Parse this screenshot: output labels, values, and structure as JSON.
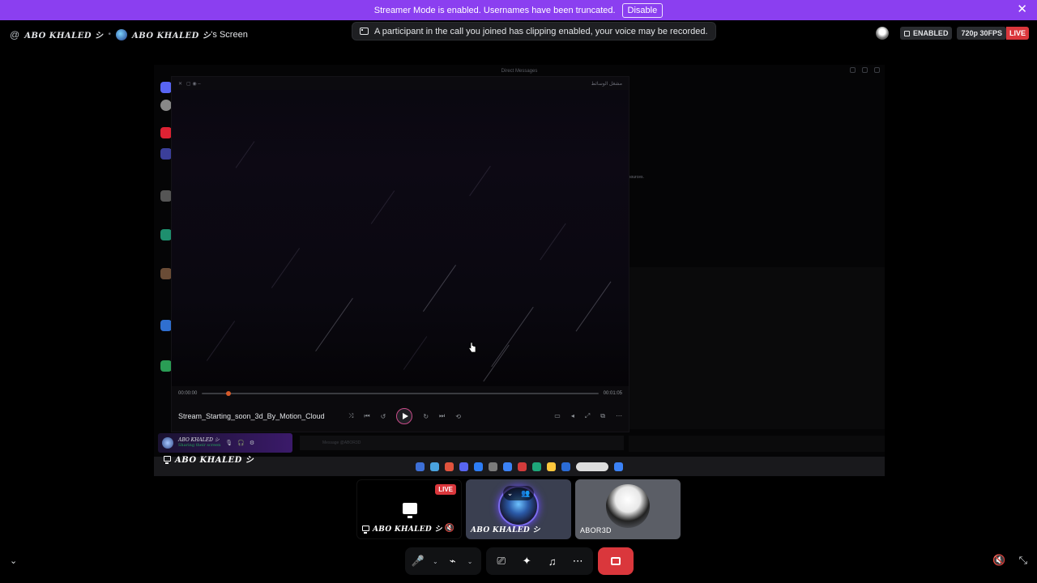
{
  "banner": {
    "text": "Streamer Mode is enabled. Usernames have been truncated.",
    "button": "Disable",
    "close": "✕"
  },
  "header": {
    "at": "@",
    "user": "ABO KHALED シ",
    "screen_owner": "ABO KHALED シ",
    "screen_suffix": "'s Screen",
    "notice": "A participant in the call you joined has clipping enabled, your voice may be recorded.",
    "enabled": "ENABLED",
    "quality": "720p 30FPS",
    "live": "LIVE"
  },
  "stream": {
    "window_title": "Direct Messages",
    "hint_text": "sources.",
    "player_header_right": "مشغل الوسائط",
    "time_start": "00:00:00",
    "time_end": "00:01:05",
    "progress": 0.06,
    "file_name": "Stream_Starting_soon_3d_By_Motion_Cloud",
    "dock_name": "ABO KHALED シ",
    "dock_status": "Sharing their screen",
    "message_placeholder": "Message @ABOR3D",
    "stream_label": "ABO KHALED シ"
  },
  "tiles": [
    {
      "label": "ABO KHALED シ",
      "badge": "LIVE"
    },
    {
      "label": "ABO KHALED シ"
    },
    {
      "label": "ABOR3D"
    }
  ],
  "colors": {
    "banner": "#8b3ff0",
    "live": "#da373c",
    "end_call": "#da373c"
  },
  "icons": [
    "microphone-icon",
    "camera-off-icon",
    "screen-share-icon",
    "activities-icon",
    "soundboard-icon",
    "more-icon",
    "leave-call-icon",
    "volume-mute-icon",
    "exit-fullscreen-icon"
  ]
}
